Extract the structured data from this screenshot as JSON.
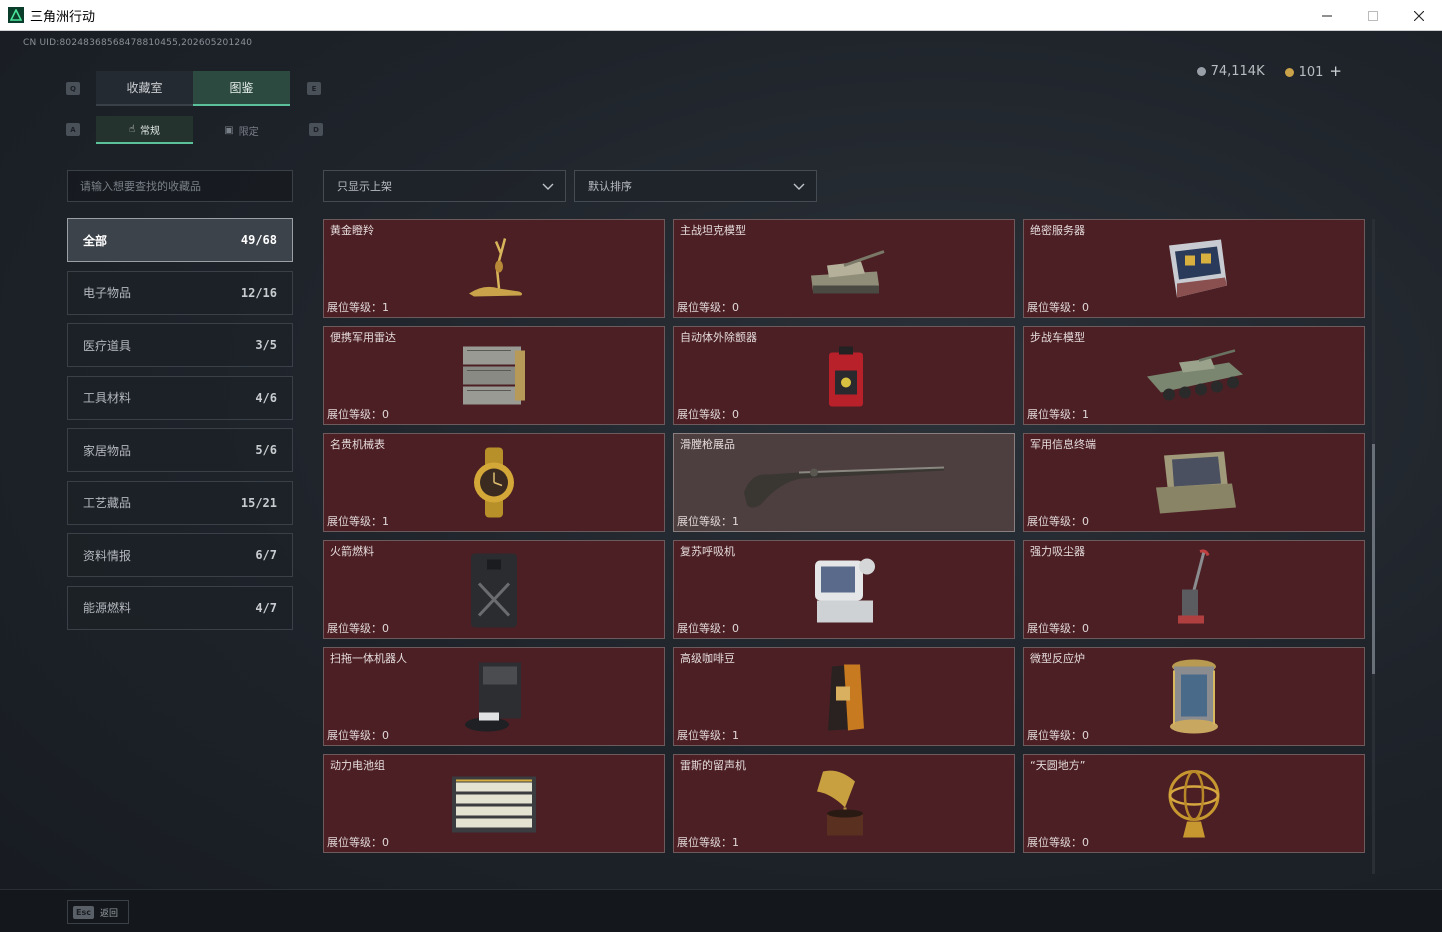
{
  "window": {
    "title": "三角洲行动",
    "controls": [
      "minimize",
      "maximize",
      "close"
    ]
  },
  "uid_text": "CN UID:8024836856847881045​5,202605201240",
  "currency": {
    "silver": "74,114K",
    "gold": "101",
    "plus": "+"
  },
  "key_hints": {
    "q": "Q",
    "e": "E",
    "a": "A",
    "d": "D"
  },
  "main_tabs": [
    {
      "label": "收藏室",
      "active": false
    },
    {
      "label": "图鉴",
      "active": true
    }
  ],
  "sub_tabs": [
    {
      "label": "常规",
      "icon": "hand-icon",
      "active": true
    },
    {
      "label": "限定",
      "icon": "image-icon",
      "active": false
    }
  ],
  "search": {
    "placeholder": "请输入想要查找的收藏品"
  },
  "filters": {
    "shelf": "只显示上架",
    "sort": "默认排序"
  },
  "categories": [
    {
      "label": "全部",
      "count": "49/68",
      "active": true
    },
    {
      "label": "电子物品",
      "count": "12/16"
    },
    {
      "label": "医疗道具",
      "count": "3/5"
    },
    {
      "label": "工具材料",
      "count": "4/6"
    },
    {
      "label": "家居物品",
      "count": "5/6"
    },
    {
      "label": "工艺藏品",
      "count": "15/21"
    },
    {
      "label": "资料情报",
      "count": "6/7"
    },
    {
      "label": "能源燃料",
      "count": "4/7"
    }
  ],
  "level_prefix": "展位等级：",
  "items": [
    {
      "name": "黄金瞪羚",
      "level": "1",
      "icon": "gazelle-icon"
    },
    {
      "name": "主战坦克模型",
      "level": "0",
      "icon": "tank-icon"
    },
    {
      "name": "绝密服务器",
      "level": "0",
      "icon": "server-icon"
    },
    {
      "name": "便携军用雷达",
      "level": "0",
      "icon": "radar-icon"
    },
    {
      "name": "自动体外除颤器",
      "level": "0",
      "icon": "defibrillator-icon"
    },
    {
      "name": "步战车模型",
      "level": "1",
      "icon": "ifv-icon"
    },
    {
      "name": "名贵机械表",
      "level": "1",
      "icon": "watch-icon"
    },
    {
      "name": "滑膛枪展品",
      "level": "1",
      "icon": "musket-icon",
      "highlight": true
    },
    {
      "name": "军用信息终端",
      "level": "0",
      "icon": "terminal-icon"
    },
    {
      "name": "火箭燃料",
      "level": "0",
      "icon": "jerrycan-icon"
    },
    {
      "name": "复苏呼吸机",
      "level": "0",
      "icon": "ventilator-icon"
    },
    {
      "name": "强力吸尘器",
      "level": "0",
      "icon": "vacuum-icon"
    },
    {
      "name": "扫拖一体机器人",
      "level": "0",
      "icon": "robot-mop-icon"
    },
    {
      "name": "高级咖啡豆",
      "level": "1",
      "icon": "coffee-bag-icon"
    },
    {
      "name": "微型反应炉",
      "level": "0",
      "icon": "reactor-icon"
    },
    {
      "name": "动力电池组",
      "level": "0",
      "icon": "battery-pack-icon"
    },
    {
      "name": "雷斯的留声机",
      "level": "1",
      "icon": "gramophone-icon"
    },
    {
      "name": "“天圆地方”",
      "level": "0",
      "icon": "armillary-sphere-icon"
    }
  ],
  "footer": {
    "esc_key": "Esc",
    "esc_label": "返回"
  },
  "colors": {
    "accent": "#5ac19a",
    "card_bg": "#4b1f24",
    "card_highlight_bg": "#4d3f3f"
  }
}
